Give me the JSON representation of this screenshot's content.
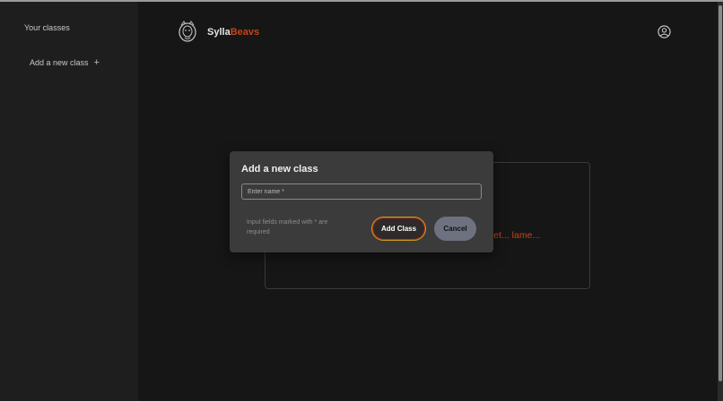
{
  "sidebar": {
    "title": "Your classes",
    "add_label": "Add a new class",
    "add_icon": "+"
  },
  "header": {
    "brand_main": "Sylla",
    "brand_accent": "Beavs",
    "accent_color": "#c4441a"
  },
  "background": {
    "empty_message": "yet... lame..."
  },
  "modal": {
    "title": "Add a new class",
    "input_placeholder": "Enter name *",
    "input_value": "",
    "required_note": "Input fields marked with * are required",
    "add_button": "Add Class",
    "cancel_button": "Cancel"
  }
}
